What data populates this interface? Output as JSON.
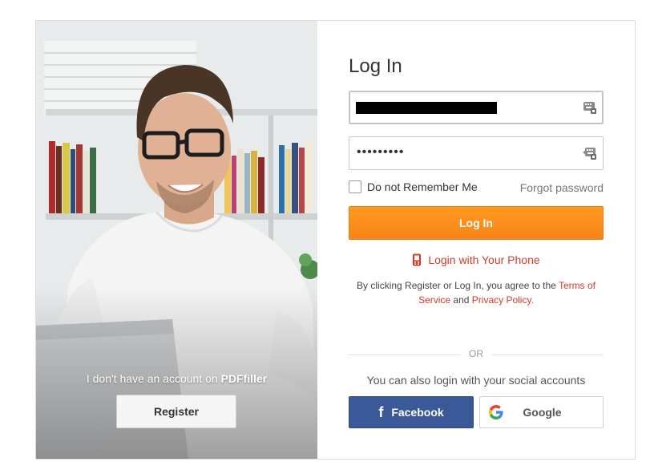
{
  "left_panel": {
    "no_account_text": "I don't have an account on ",
    "brand": "PDFfiller",
    "register_label": "Register"
  },
  "form": {
    "title": "Log In",
    "password_mask": "•••••••••",
    "remember_label": "Do not Remember Me",
    "forgot_label": "Forgot password",
    "login_button": "Log In",
    "phone_login_label": "Login with Your Phone",
    "terms_prefix": "By clicking Register or Log In, you agree to the ",
    "terms_link": "Terms of Service",
    "terms_and": " and ",
    "privacy_link": "Privacy Policy.",
    "or_label": "OR",
    "social_text": "You can also login with your social accounts",
    "facebook_label": "Facebook",
    "google_label": "Google"
  },
  "colors": {
    "accent_orange": "#f7841a",
    "link_red": "#d5392a",
    "facebook_blue": "#3b5998"
  },
  "icons": {
    "field_icon": "keyboard-icon",
    "phone_icon": "mobile-phone-icon",
    "facebook_icon": "facebook-f-icon",
    "google_icon": "google-g-icon"
  }
}
